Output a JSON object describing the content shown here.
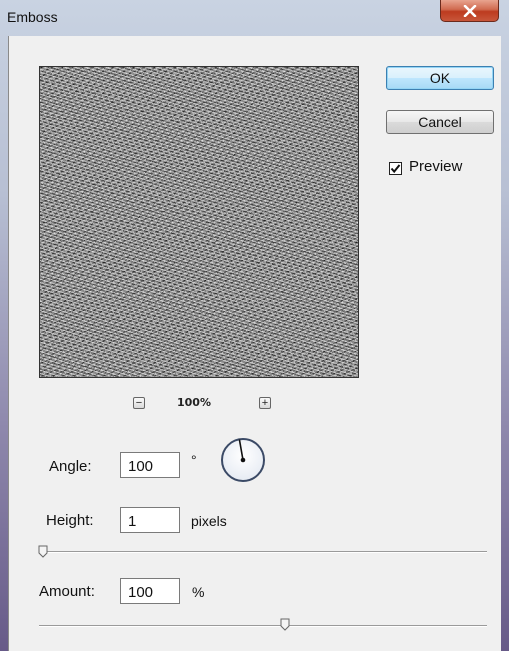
{
  "window": {
    "title": "Emboss",
    "close_glyph": "x"
  },
  "preview": {
    "zoom_out_glyph": "−",
    "zoom_in_glyph": "+",
    "zoom_level": "100%"
  },
  "buttons": {
    "ok": "OK",
    "cancel": "Cancel"
  },
  "preview_toggle": {
    "label": "Preview",
    "checked": true
  },
  "fields": {
    "angle": {
      "label": "Angle:",
      "value": "100",
      "unit": "°"
    },
    "height": {
      "label": "Height:",
      "value": "1",
      "unit": "pixels",
      "slider_fraction": 0.0
    },
    "amount": {
      "label": "Amount:",
      "value": "100",
      "unit": "%",
      "slider_fraction": 0.56
    }
  },
  "colors": {
    "ok_border": "#3c7fb1",
    "close_red": "#c8563a"
  }
}
